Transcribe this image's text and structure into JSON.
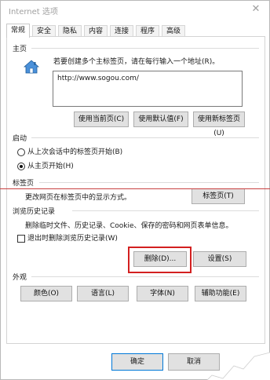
{
  "window": {
    "title": "Internet 选项",
    "close_glyph": "✕"
  },
  "tabs": [
    {
      "label": "常规",
      "active": true
    },
    {
      "label": "安全",
      "active": false
    },
    {
      "label": "隐私",
      "active": false
    },
    {
      "label": "内容",
      "active": false
    },
    {
      "label": "连接",
      "active": false
    },
    {
      "label": "程序",
      "active": false
    },
    {
      "label": "高级",
      "active": false
    }
  ],
  "homepage": {
    "section_label": "主页",
    "hint": "若要创建多个主标签页，请在每行输入一个地址(R)。",
    "url": "http://www.sogou.com/",
    "buttons": {
      "use_current": "使用当前页(C)",
      "use_default": "使用默认值(F)",
      "use_new_tab": "使用新标签页(U)"
    }
  },
  "startup": {
    "section_label": "启动",
    "options": [
      {
        "label": "从上次会话中的标签页开始(B)",
        "checked": false
      },
      {
        "label": "从主页开始(H)",
        "checked": true
      }
    ]
  },
  "tabs_section": {
    "section_label": "标签页",
    "description": "更改网页在标签页中的显示方式。",
    "button": "标签页(T)"
  },
  "history": {
    "section_label": "浏览历史记录",
    "description": "删除临时文件、历史记录、Cookie、保存的密码和网页表单信息。",
    "checkbox_label": "退出时删除浏览历史记录(W)",
    "checkbox_checked": false,
    "delete_button": "删除(D)...",
    "settings_button": "设置(S)"
  },
  "appearance": {
    "section_label": "外观",
    "buttons": {
      "colors": "颜色(O)",
      "languages": "语言(L)",
      "fonts": "字体(N)",
      "accessibility": "辅助功能(E)"
    }
  },
  "footer": {
    "ok": "确定",
    "cancel": "取消"
  },
  "colors": {
    "highlight": "#d32020",
    "default_button_border": "#0078d7",
    "button_face": "#e1e1e1"
  }
}
